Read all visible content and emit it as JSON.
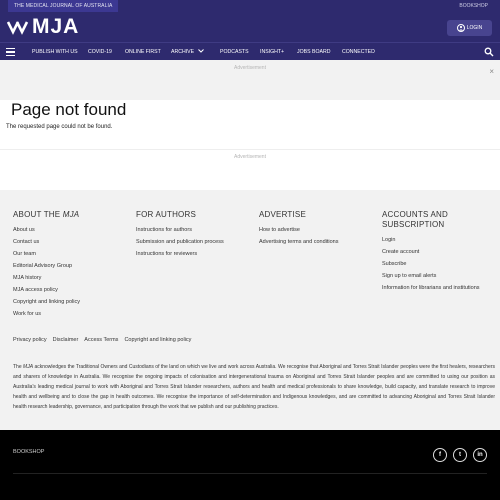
{
  "topstrip": {
    "journal_tab": "THE MEDICAL JOURNAL OF AUSTRALIA",
    "bookshop": "BOOKSHOP"
  },
  "brand": {
    "wordmark": "MJA",
    "login_label": "LOGIN",
    "accent": "#2e2a6e"
  },
  "nav": {
    "items": [
      "PUBLISH WITH US",
      "COVID-19",
      "ONLINE FIRST",
      "ARCHIVE",
      "PODCASTS",
      "INSIGHT+",
      "JOBS BOARD",
      "CONNECTED"
    ],
    "icons": {
      "menu": "hamburger-icon",
      "search": "search-icon",
      "archive_caret": "chevron-down-icon"
    }
  },
  "ads": {
    "top_label": "Advertisement",
    "bottom_label": "Advertisement",
    "close": "×"
  },
  "content": {
    "title": "Page not found",
    "message": "The requested page could not be found."
  },
  "footer": {
    "about": {
      "heading_prefix": "ABOUT THE ",
      "heading_em": "MJA",
      "links": [
        "About us",
        "Contact us",
        "Our team",
        "Editorial Advisory Group",
        "MJA history",
        "MJA access policy",
        "Copyright and linking policy",
        "Work for us"
      ]
    },
    "authors": {
      "heading": "FOR AUTHORS",
      "links": [
        "Instructions for authors",
        "Submission and publication process",
        "Instructions for reviewers"
      ]
    },
    "advertise": {
      "heading": "ADVERTISE",
      "links": [
        "How to advertise",
        "Advertising terms and conditions"
      ]
    },
    "accounts": {
      "heading": "ACCOUNTS AND SUBSCRIPTION",
      "links": [
        "Login",
        "Create account",
        "Subscribe",
        "Sign up to email alerts",
        "Information for librarians and institutions"
      ]
    },
    "policy_links": [
      "Privacy policy",
      "Disclaimer",
      "Access Terms",
      "Copyright and linking policy"
    ],
    "ack_prefix": "The ",
    "ack_em": "MJA",
    "ack_text": " acknowledges the Traditional Owners and Custodians of the land on which we live and work across Australia. We recognise that Aboriginal and Torres Strait Islander peoples were the first healers, researchers and sharers of knowledge in Australia. We recognise the ongoing impacts of colonisation and intergenerational trauma on Aboriginal and Torres Strait Islander peoples and are committed to using our position as Australia's leading medical journal to work with Aboriginal and Torres Strait Islander researchers, authors and health and medical professionals to share knowledge, build capacity, and translate research to improve health and wellbeing and to close the gap in health outcomes. We recognise the importance of self-determination and Indigenous knowledges, and are committed to advancing Aboriginal and Torres Strait Islander health research leadership, governance, and participation through the work that we publish and our publishing practices.",
    "bottom": {
      "bookshop": "BOOKSHOP",
      "social": [
        "f",
        "t",
        "in"
      ],
      "social_icons": [
        "facebook-icon",
        "twitter-icon",
        "linkedin-icon"
      ]
    }
  }
}
